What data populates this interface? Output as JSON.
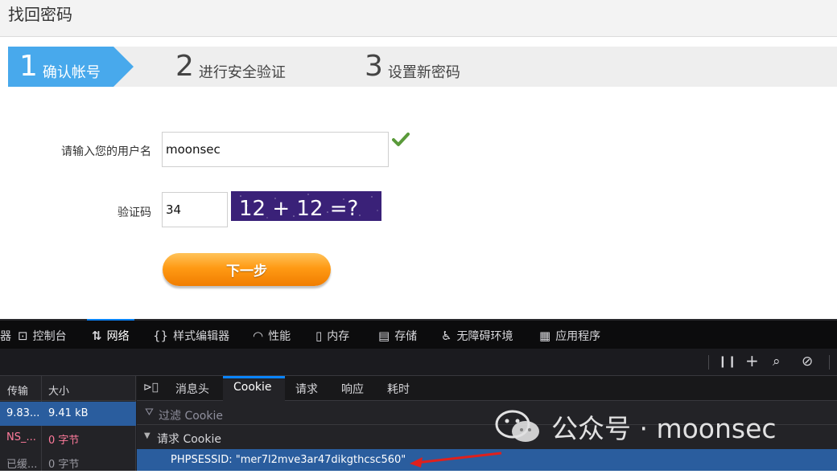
{
  "page": {
    "title": "找回密码",
    "steps": [
      {
        "num": "1",
        "label": "确认帐号",
        "active": true
      },
      {
        "num": "2",
        "label": "进行安全验证",
        "active": false
      },
      {
        "num": "3",
        "label": "设置新密码",
        "active": false
      }
    ],
    "form": {
      "username_label": "请输入您的用户名",
      "username_value": "moonsec",
      "captcha_label": "验证码",
      "captcha_value": "34",
      "captcha_image_text": "12 + 12 =?",
      "next_button": "下一步"
    },
    "colors": {
      "step_active": "#48a9ec",
      "button": "#ff9a14",
      "check": "#5a9a3a"
    }
  },
  "devtools": {
    "tabs": [
      {
        "icon": "inspector-icon",
        "label": "器"
      },
      {
        "icon": "console-icon",
        "label": "控制台"
      },
      {
        "icon": "network-icon",
        "label": "网络"
      },
      {
        "icon": "style-editor-icon",
        "label": "样式编辑器"
      },
      {
        "icon": "performance-icon",
        "label": "性能"
      },
      {
        "icon": "memory-icon",
        "label": "内存"
      },
      {
        "icon": "storage-icon",
        "label": "存储"
      },
      {
        "icon": "accessibility-icon",
        "label": "无障碍环境"
      },
      {
        "icon": "application-icon",
        "label": "应用程序"
      }
    ],
    "active_tab": "网络",
    "table": {
      "columns": [
        "传输",
        "大小"
      ],
      "rows": [
        {
          "transfer": "9.83...",
          "size": "9.41 kB"
        },
        {
          "transfer": "NS_...",
          "size": "0 字节"
        },
        {
          "transfer": "已缓...",
          "size": "0 字节"
        }
      ]
    },
    "panel": {
      "tabs": [
        "消息头",
        "Cookie",
        "请求",
        "响应",
        "耗时"
      ],
      "active_tab": "Cookie",
      "filter_placeholder": "过滤 Cookie",
      "section": "请求 Cookie",
      "cookie_line": "PHPSESSID: \"mer7l2mve3ar47dikgthcsc560\""
    }
  },
  "watermark": {
    "text": "公众号 · moonsec"
  }
}
